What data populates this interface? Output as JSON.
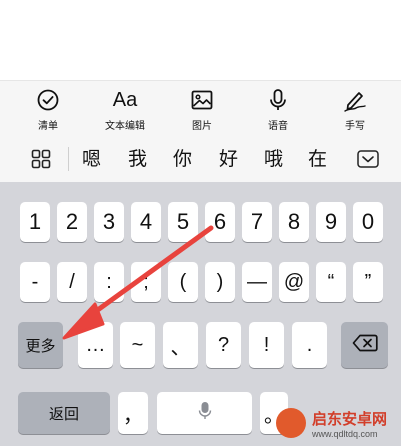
{
  "toolbar": {
    "items": [
      {
        "label": "清单",
        "icon": "checklist-icon"
      },
      {
        "label": "文本编辑",
        "icon_text": "Aa"
      },
      {
        "label": "图片",
        "icon": "image-icon"
      },
      {
        "label": "语音",
        "icon": "microphone-icon"
      },
      {
        "label": "手写",
        "icon": "handwriting-pen-icon"
      }
    ]
  },
  "candidates": {
    "grid_icon": "grid-icon",
    "words": [
      "嗯",
      "我",
      "你",
      "好",
      "哦",
      "在"
    ],
    "collapse_icon": "chevron-down-icon"
  },
  "keyboard": {
    "row1": [
      "1",
      "2",
      "3",
      "4",
      "5",
      "6",
      "7",
      "8",
      "9",
      "0"
    ],
    "row2": [
      "-",
      "/",
      ":",
      ";",
      "(",
      ")",
      "—",
      "@",
      "“",
      "”"
    ],
    "row3": {
      "more": "更多",
      "keys": [
        "…",
        "~",
        "、",
        "?",
        "!",
        "."
      ],
      "backspace_icon": "backspace-icon"
    },
    "row4": {
      "back": "返回",
      "comma": "，",
      "space_icon": "microphone-icon",
      "period": "。"
    }
  },
  "watermark": {
    "title": "启东安卓网",
    "url": "www.qdltdq.com"
  },
  "colors": {
    "keyboard_bg": "#d4d5da",
    "key_bg": "#ffffff",
    "function_key_bg": "#adb1b9",
    "toolbar_bg": "#f6f6f6",
    "arrow": "#e8433d",
    "watermark_brand": "#d23e2a"
  }
}
